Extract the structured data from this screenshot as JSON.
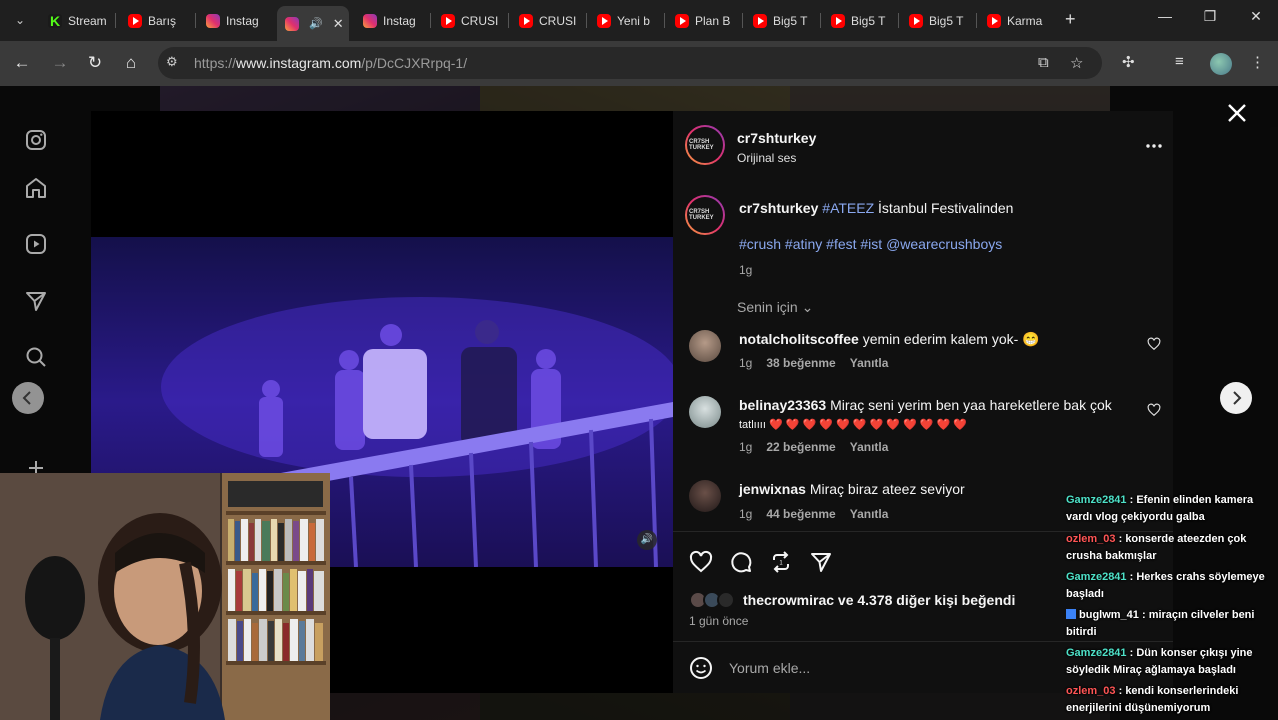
{
  "browser": {
    "tabs": [
      {
        "label": "Stream",
        "favicon": "kick-icon"
      },
      {
        "label": "Barış",
        "favicon": "youtube-icon"
      },
      {
        "label": "Instag",
        "favicon": "instagram-icon"
      },
      {
        "label": "",
        "favicon": "instagram-icon",
        "active": true
      },
      {
        "label": "Instag",
        "favicon": "instagram-icon"
      },
      {
        "label": "CRUSI",
        "favicon": "youtube-icon"
      },
      {
        "label": "CRUSI",
        "favicon": "youtube-icon"
      },
      {
        "label": "Yeni b",
        "favicon": "youtube-icon"
      },
      {
        "label": "Plan B",
        "favicon": "youtube-icon"
      },
      {
        "label": "Big5 T",
        "favicon": "youtube-icon"
      },
      {
        "label": "Big5 T",
        "favicon": "youtube-icon"
      },
      {
        "label": "Big5 T",
        "favicon": "youtube-icon"
      },
      {
        "label": "Karma",
        "favicon": "youtube-icon"
      }
    ],
    "url_prefix": "https://",
    "url_host": "www.instagram.com",
    "url_path": "/p/DcCJXRrpq-1/"
  },
  "post": {
    "author": "cr7shturkey",
    "audio_label": "Orijinal ses",
    "avatar_text": "CR7SH TURKEY",
    "caption_user": "cr7shturkey",
    "caption_hashtag": "#ATEEZ",
    "caption_text": "İstanbul Festivalinden",
    "caption_tags": "#crush #atiny #fest #ist @wearecrushboys",
    "caption_time": "1g",
    "for_you_label": "Senin için",
    "likes_text": "thecrowmirac ve 4.378 diğer kişi beğendi",
    "posted_time": "1 gün önce",
    "comment_placeholder": "Yorum ekle..."
  },
  "comments": [
    {
      "user": "notalcholitscoffee",
      "text": "yemin ederim kalem yok- 😁",
      "time": "1g",
      "likes": "38 beğenme",
      "reply": "Yanıtla"
    },
    {
      "user": "belinay23363",
      "text": "Miraç seni yerim ben yaa hareketlere bak çok",
      "text2": "tatlıııı ❤️ ❤️ ❤️ ❤️ ❤️ ❤️ ❤️ ❤️ ❤️ ❤️ ❤️ ❤️",
      "time": "1g",
      "likes": "22 beğenme",
      "reply": "Yanıtla"
    },
    {
      "user": "jenwixnas",
      "text": "Miraç biraz ateez seviyor",
      "time": "1g",
      "likes": "44 beğenme",
      "reply": "Yanıtla"
    }
  ],
  "chat": [
    {
      "nick": "Gamze2841",
      "color": "teal",
      "msg": ": Efenin elinden kamera vardı vlog çekiyordu galba"
    },
    {
      "nick": "ozlem_03",
      "color": "red",
      "msg": ": konserde ateezden çok crusha bakmışlar"
    },
    {
      "nick": "Gamze2841",
      "color": "teal",
      "msg": ": Herkes crahs söylemeye başladı"
    },
    {
      "nick": "buglwm_41",
      "color": "white",
      "badge": true,
      "msg": ": miraçın cilveler beni bitirdi"
    },
    {
      "nick": "Gamze2841",
      "color": "teal",
      "msg": ": Dün konser çıkışı yine söyledik Miraç ağlamaya başladı"
    },
    {
      "nick": "ozlem_03",
      "color": "red",
      "msg": ": kendi konserlerindeki enerjilerini düşünemiyorum"
    }
  ],
  "colors": {
    "link": "#8aa8ef",
    "panel": "#101010",
    "teal_nick": "#4ee1c8",
    "red_nick": "#ff5555"
  }
}
